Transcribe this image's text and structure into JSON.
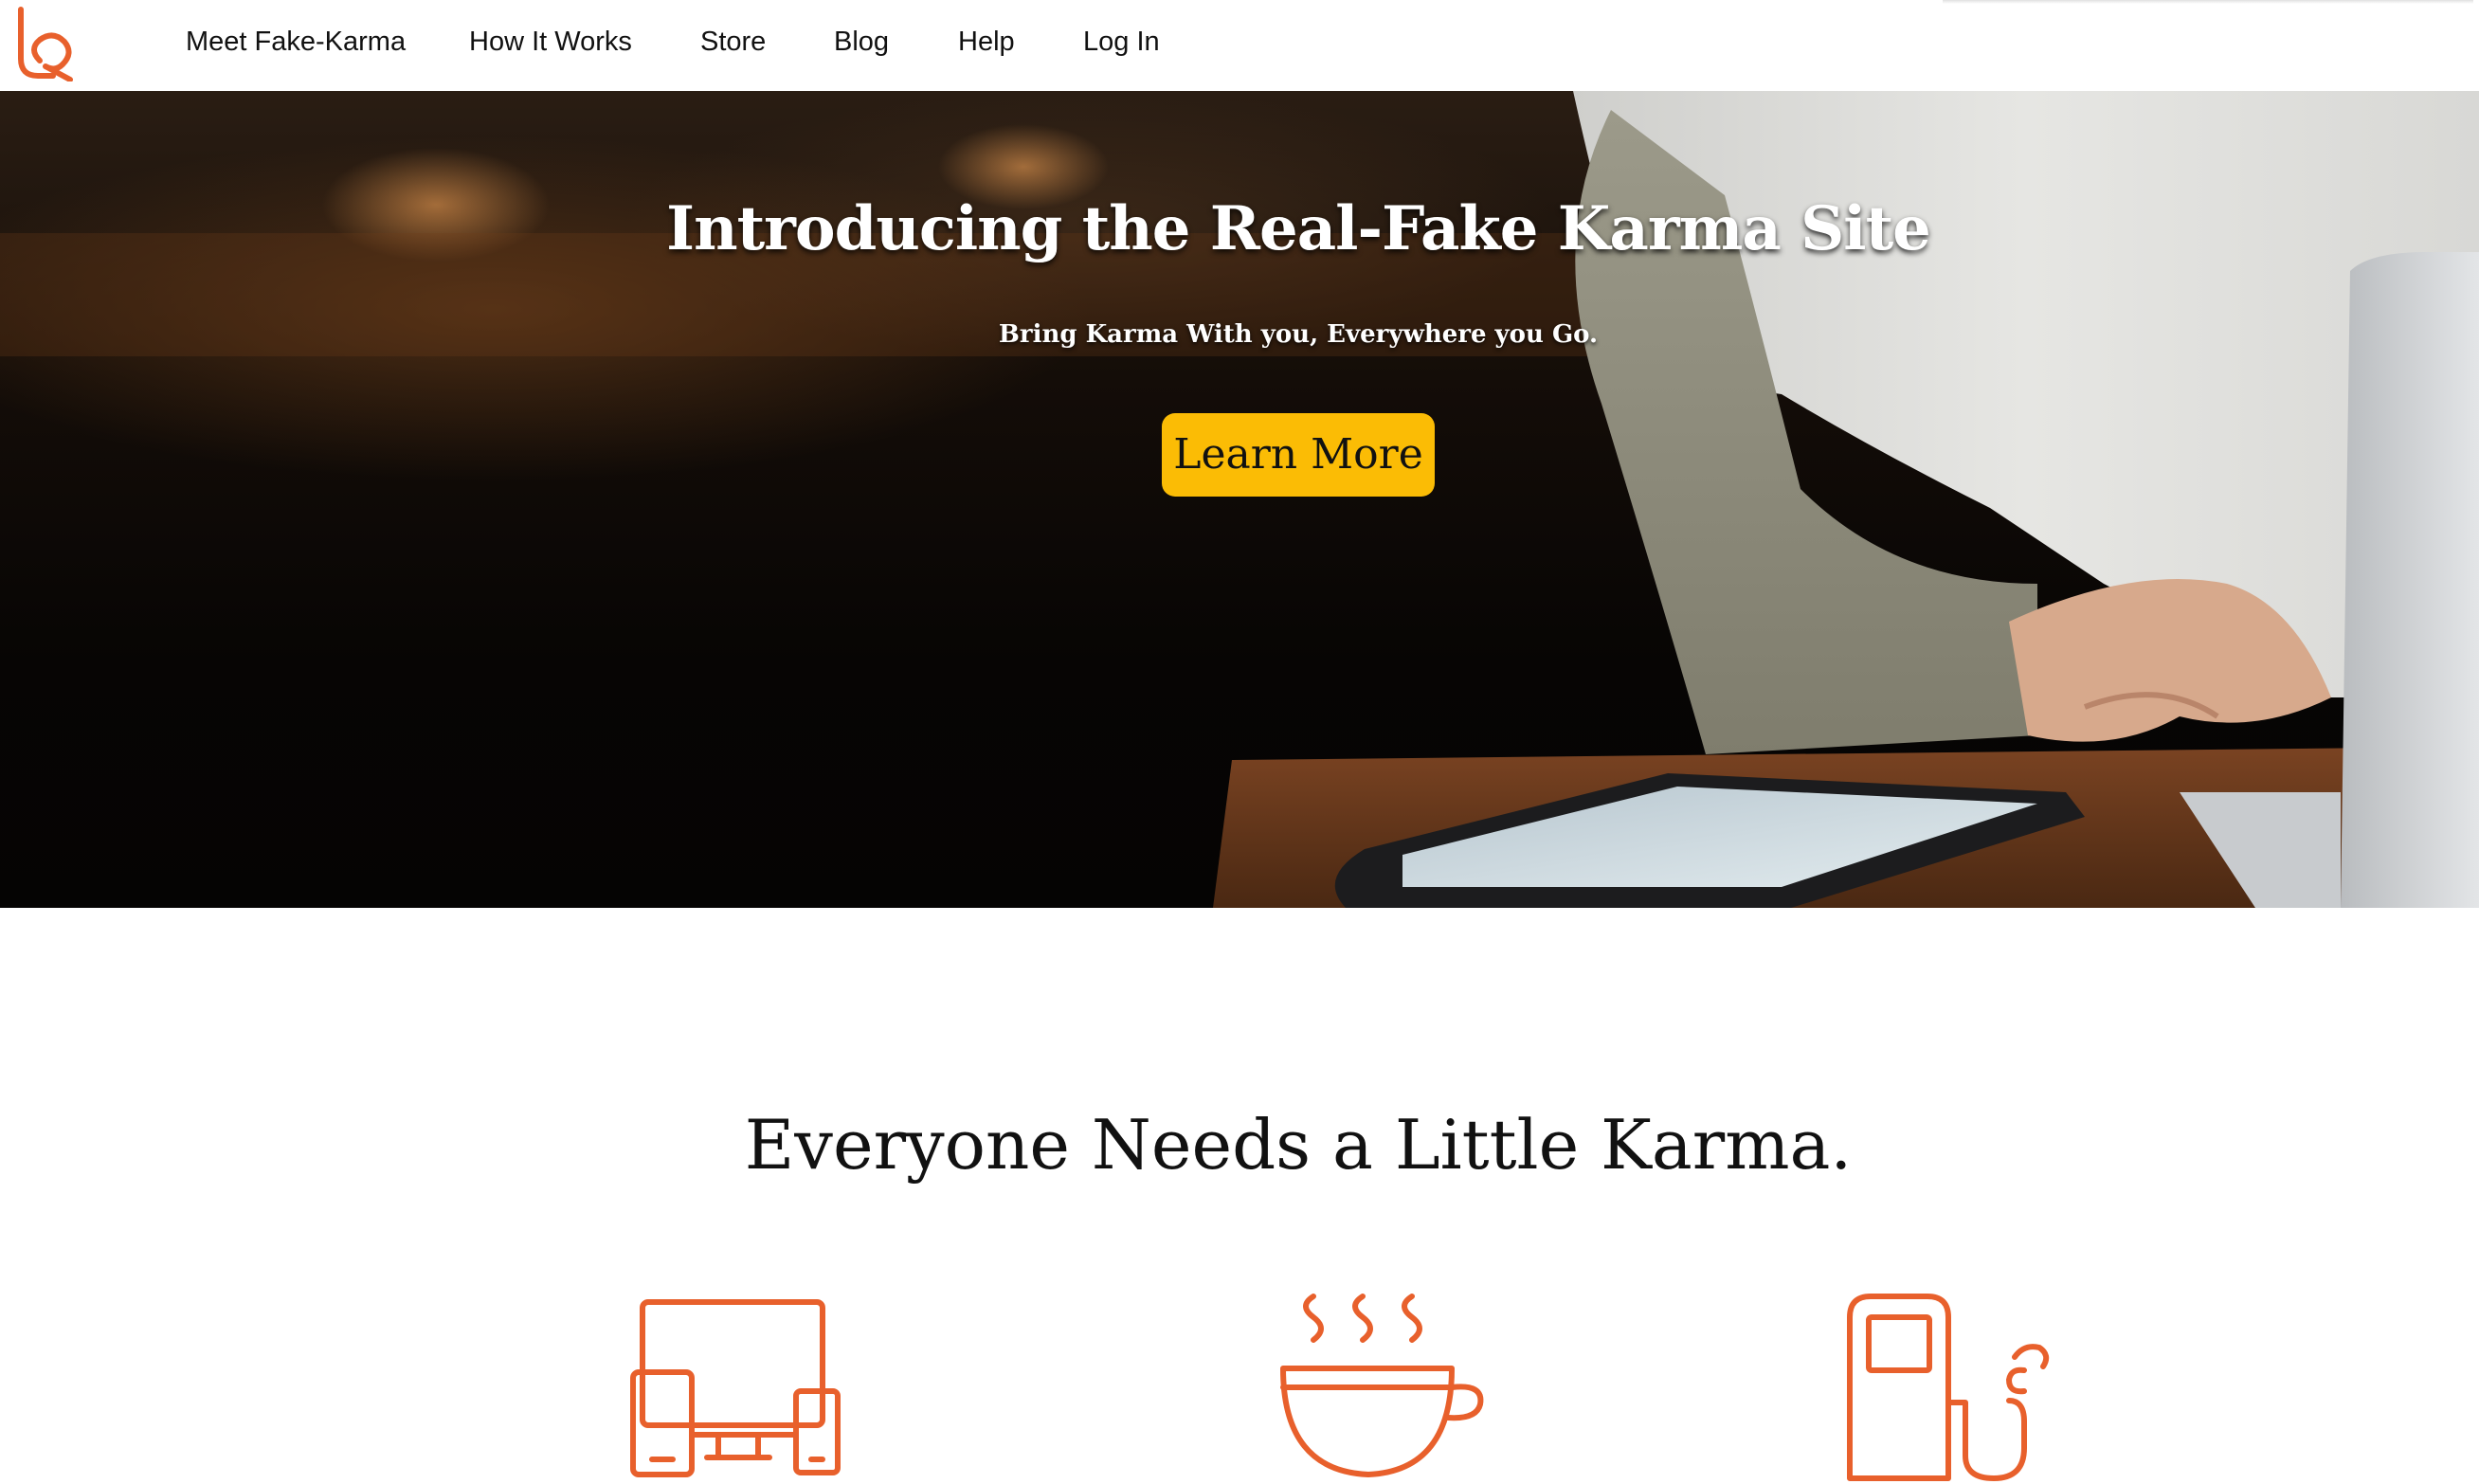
{
  "brand": {
    "logo_icon": "karma-logo-icon",
    "accent_color": "#e8602c"
  },
  "nav": {
    "items": [
      {
        "label": "Meet Fake-Karma"
      },
      {
        "label": "How It Works"
      },
      {
        "label": "Store"
      },
      {
        "label": "Blog"
      },
      {
        "label": "Help"
      },
      {
        "label": "Log In"
      }
    ]
  },
  "hero": {
    "title": "Introducing the Real-Fake Karma Site",
    "subtitle": "Bring Karma With you, Everywhere you Go.",
    "cta_label": "Learn More",
    "cta_color": "#fbbc05",
    "background_image": "person-with-laptop-and-tablet-in-cafe"
  },
  "features": {
    "heading": "Everyone Needs a Little Karma.",
    "icons": [
      {
        "icon": "devices-icon"
      },
      {
        "icon": "coffee-cup-icon"
      },
      {
        "icon": "fuel-pump-icon"
      }
    ],
    "icon_color": "#e8602c"
  }
}
